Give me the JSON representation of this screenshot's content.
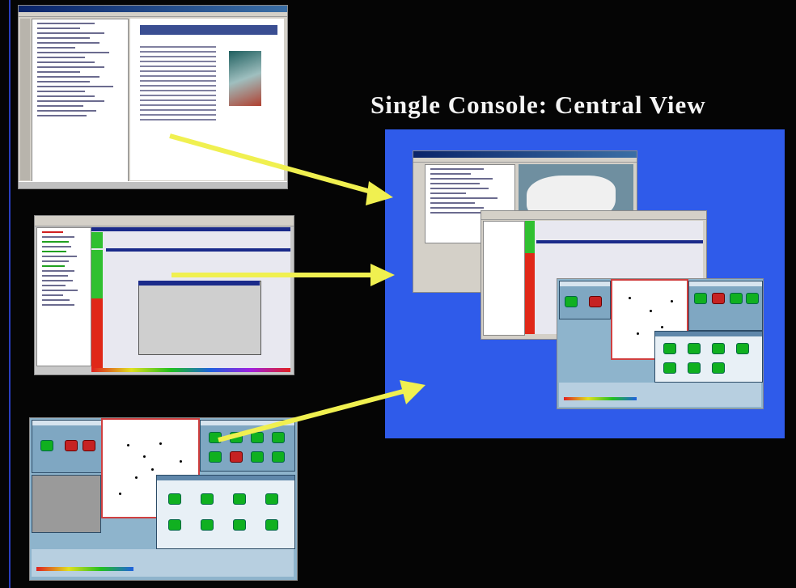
{
  "slide": {
    "title": "Single Console: Central View"
  },
  "colors": {
    "background": "#000000",
    "console": "#2f5bea",
    "arrow": "#f0f050",
    "status_red": "#e03020",
    "status_green": "#20c040"
  },
  "icons": [
    "arrow-icon",
    "tree-icon",
    "map-icon",
    "network-node-icon"
  ]
}
